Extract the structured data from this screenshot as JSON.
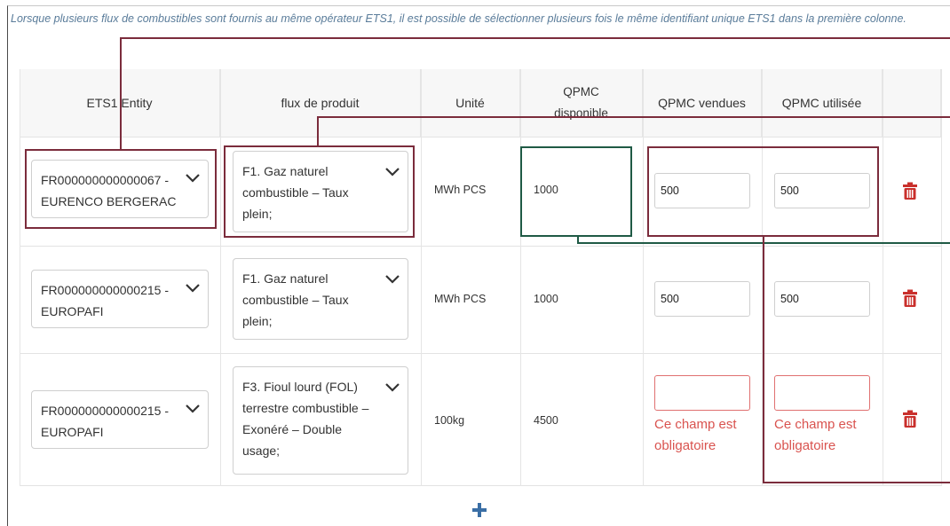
{
  "note": "Lorsque plusieurs flux de combustibles sont fournis au même opérateur ETS1, il est possible de sélectionner plusieurs fois le même identifiant unique ETS1 dans la première colonne.",
  "headers": {
    "entity": "ETS1 Entity",
    "flux": "flux de produit",
    "unite": "Unité",
    "qpmc_dispo": "QPMC disponible",
    "qpmc_vendues": "QPMC vendues",
    "qpmc_utilisee": "QPMC utilisée"
  },
  "rows": [
    {
      "entity": "FR000000000000067 - EURENCO BERGERAC",
      "flux": "F1. Gaz naturel combustible – Taux plein;",
      "unite": "MWh PCS",
      "dispo": "1000",
      "vendues": "500",
      "utilisee": "500"
    },
    {
      "entity": "FR000000000000215 - EUROPAFI",
      "flux": "F1. Gaz naturel combustible – Taux plein;",
      "unite": "MWh PCS",
      "dispo": "1000",
      "vendues": "500",
      "utilisee": "500"
    },
    {
      "entity": "FR000000000000215 - EUROPAFI",
      "flux": "F3. Fioul lourd (FOL) terrestre combustible – Exonéré – Double usage;",
      "unite": "100kg",
      "dispo": "4500",
      "vendues": "",
      "utilisee": "",
      "error": "Ce champ est obligatoire"
    }
  ],
  "icons": {
    "chevron": "chevron-down-icon",
    "delete": "trash-icon",
    "add": "plus-icon"
  },
  "colors": {
    "annotation_red": "#7b2c3c",
    "annotation_green": "#1f5a45",
    "error": "#d9534f",
    "trash": "#c9302c",
    "plus": "#3a6ea5"
  }
}
